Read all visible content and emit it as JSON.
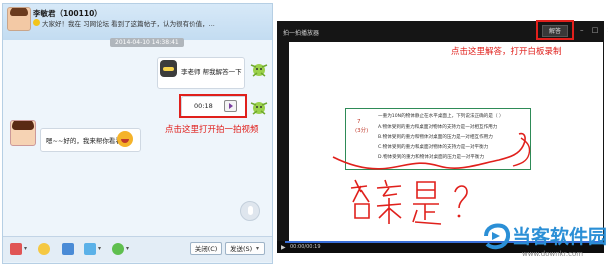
{
  "chat": {
    "contact_name": "李敏君（100110）",
    "contact_signature": "大家好！我在 习网论坛 看到了这篇帖子，认为很有价值，...",
    "timestamp": "2014-04-10 14:38:41",
    "messages": [
      {
        "text": "李老师 帮我解答一下",
        "side": "right"
      },
      {
        "video_duration": "00:18",
        "side": "right"
      },
      {
        "text": "嗯~~好的，我来帮你看看",
        "side": "left"
      }
    ],
    "annotation_video": "点击这里打开拍一拍视频",
    "toolbar": {
      "close_label": "关闭(C)",
      "send_label": "发送(S)",
      "dropdown_arrow": "▾"
    }
  },
  "player": {
    "title": "拍一拍播放器",
    "answer_button": "解答",
    "window_controls": "– □ ×",
    "annotation_answer": "点击这里解答，打开白板录制",
    "slide": {
      "question_number": "7",
      "question_score": "(3分)",
      "lines": [
        "一重为10N的物体静止在水平桌面上，下列说法正确的是（    ）",
        "A.物体受到的重力和桌面对物体的支持力是一对相互作用力",
        "B.物体受到的重力和物体对桌面的压力是一对相互作用力",
        "C.物体受到的重力和桌面对物体的支持力是一对平衡力",
        "D.物体受到的重力和物体对桌面的压力是一对平衡力"
      ]
    },
    "handwriting": "答案是？",
    "time": "00:00/00:19",
    "play_symbol": "▶"
  },
  "watermark": {
    "title": "当客软件园",
    "url": "www.downkr.com"
  },
  "colors": {
    "accent_red": "#e0201c",
    "watermark_blue": "#2b8fd6",
    "player_bg": "#151515"
  }
}
